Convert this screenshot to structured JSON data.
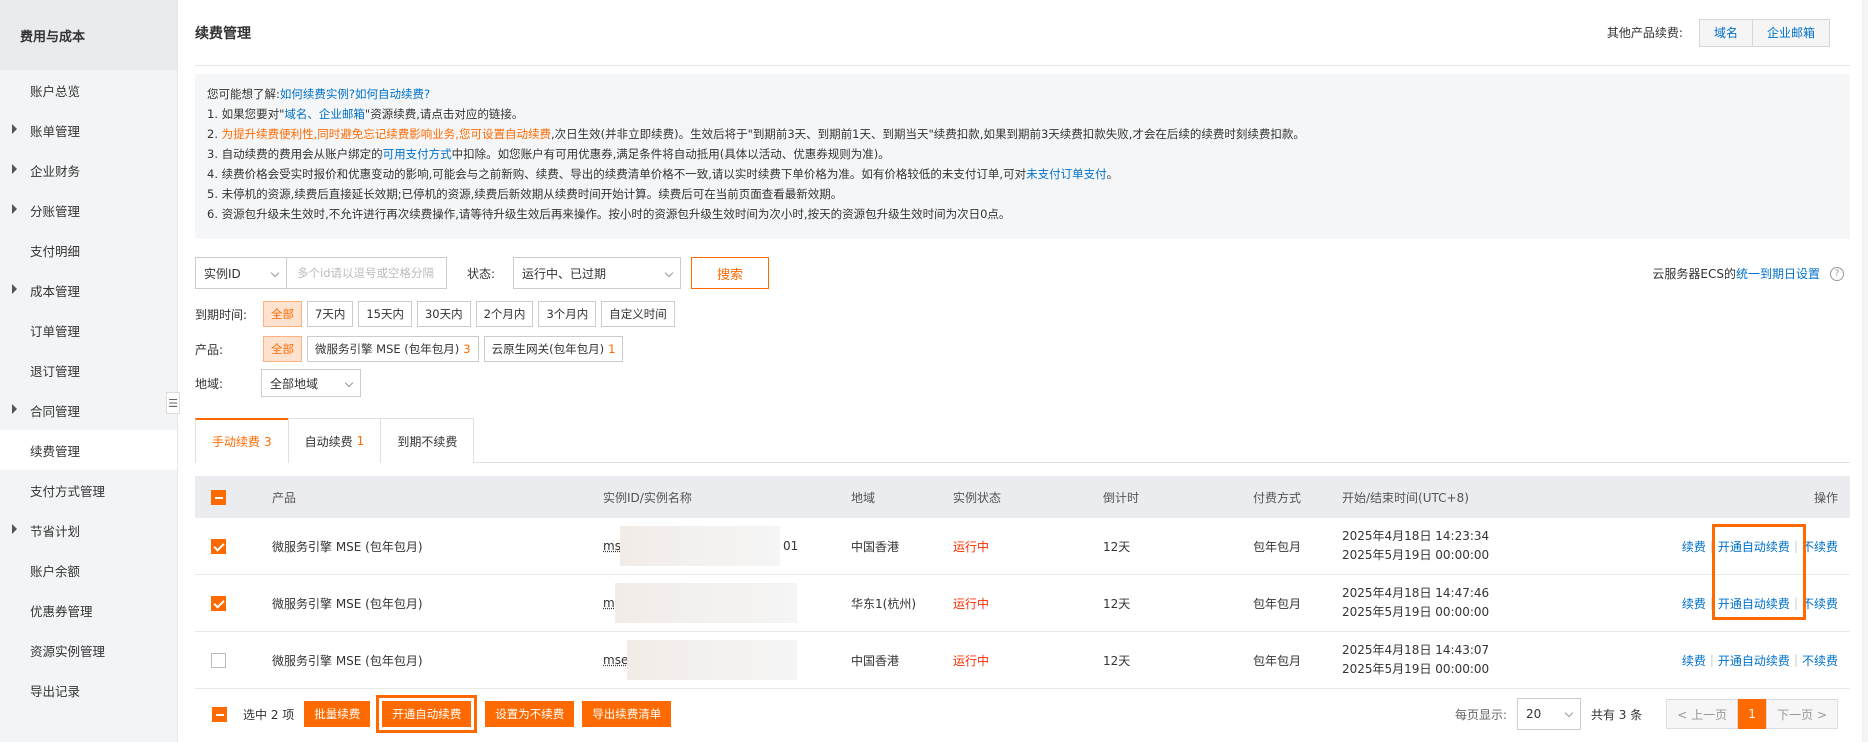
{
  "sidebar": {
    "header": "费用与成本",
    "items": [
      {
        "label": "账户总览",
        "caret": false
      },
      {
        "label": "账单管理",
        "caret": true
      },
      {
        "label": "企业财务",
        "caret": true
      },
      {
        "label": "分账管理",
        "caret": true
      },
      {
        "label": "支付明细",
        "caret": false
      },
      {
        "label": "成本管理",
        "caret": true
      },
      {
        "label": "订单管理",
        "caret": false
      },
      {
        "label": "退订管理",
        "caret": false
      },
      {
        "label": "合同管理",
        "caret": true
      },
      {
        "label": "续费管理",
        "caret": false,
        "active": true
      },
      {
        "label": "支付方式管理",
        "caret": false
      },
      {
        "label": "节省计划",
        "caret": true
      },
      {
        "label": "账户余额",
        "caret": false
      },
      {
        "label": "优惠券管理",
        "caret": false
      },
      {
        "label": "资源实例管理",
        "caret": false
      },
      {
        "label": "导出记录",
        "caret": false
      }
    ],
    "collapse_icon": "☰"
  },
  "header": {
    "title": "续费管理",
    "other_label": "其他产品续费:",
    "other_buttons": [
      "域名",
      "企业邮箱"
    ]
  },
  "notice": {
    "intro": "您可能想了解:",
    "intro_link": "如何续费实例?如何自动续费?",
    "l1_a": "1. 如果您要对\"",
    "l1_link": "域名、企业邮箱",
    "l1_b": "\"资源续费,请点击对应的链接。",
    "l2_a": "2. ",
    "l2_orange": "为提升续费便利性,同时避免忘记续费影响业务,您可设置自动续费",
    "l2_b": ",次日生效(并非立即续费)。生效后将于\"到期前3天、到期前1天、到期当天\"续费扣款,如果到期前3天续费扣款失败,才会在后续的续费时刻续费扣款。",
    "l3_a": "3. 自动续费的费用会从账户绑定的",
    "l3_link": "可用支付方式",
    "l3_b": "中扣除。如您账户有可用优惠券,满足条件将自动抵用(具体以活动、优惠券规则为准)。",
    "l4_a": "4. 续费价格会受实时报价和优惠变动的影响,可能会与之前新购、续费、导出的续费清单价格不一致,请以实时续费下单价格为准。如有价格较低的未支付订单,可对",
    "l4_link": "未支付订单支付",
    "l4_b": "。",
    "l5": "5. 未停机的资源,续费后直接延长效期;已停机的资源,续费后新效期从续费时间开始计算。续费后可在当前页面查看最新效期。",
    "l6": "6. 资源包升级未生效时,不允许进行再次续费操作,请等待升级生效后再来操作。按小时的资源包升级生效时间为次小时,按天的资源包升级生效时间为次日0点。"
  },
  "filter": {
    "id_select": "实例ID",
    "id_placeholder": "多个id请以逗号或空格分隔",
    "status_label": "状态:",
    "status_value": "运行中、已过期",
    "search_label": "搜索",
    "ecs_text": "云服务器ECS的",
    "ecs_link": "统一到期日设置",
    "help_icon": "?"
  },
  "expire": {
    "label": "到期时间:",
    "options": [
      "全部",
      "7天内",
      "15天内",
      "30天内",
      "2个月内",
      "3个月内",
      "自定义时间"
    ]
  },
  "product": {
    "label": "产品:",
    "options": [
      {
        "label": "全部",
        "count": ""
      },
      {
        "label": "微服务引擎 MSE (包年包月)",
        "count": "3"
      },
      {
        "label": "云原生网关(包年包月)",
        "count": "1"
      }
    ]
  },
  "region": {
    "label": "地域:",
    "value": "全部地域"
  },
  "tabs": [
    {
      "label": "手动续费",
      "count": "3"
    },
    {
      "label": "自动续费",
      "count": "1"
    },
    {
      "label": "到期不续费",
      "count": ""
    }
  ],
  "table": {
    "columns": {
      "product": "产品",
      "instance": "实例ID/实例名称",
      "region": "地域",
      "status": "实例状态",
      "countdown": "倒计时",
      "billing": "付费方式",
      "time": "开始/结束时间(UTC+8)",
      "ops": "操作"
    },
    "rows": [
      {
        "checked": true,
        "product": "微服务引擎 MSE (包年包月)",
        "instance_prefix": "mse_",
        "instance_suffix": "01",
        "region": "中国香港",
        "status": "运行中",
        "countdown": "12天",
        "billing": "包年包月",
        "start": "2025年4月18日 14:23:34",
        "end": "2025年5月19日 00:00:00"
      },
      {
        "checked": true,
        "product": "微服务引擎 MSE (包年包月)",
        "instance_prefix": "ms",
        "instance_suffix": "",
        "region": "华东1(杭州)",
        "status": "运行中",
        "countdown": "12天",
        "billing": "包年包月",
        "start": "2025年4月18日 14:47:46",
        "end": "2025年5月19日 00:00:00"
      },
      {
        "checked": false,
        "product": "微服务引擎 MSE (包年包月)",
        "instance_prefix": "mse_p",
        "instance_suffix": "",
        "region": "中国香港",
        "status": "运行中",
        "countdown": "12天",
        "billing": "包年包月",
        "start": "2025年4月18日 14:43:07",
        "end": "2025年5月19日 00:00:00"
      }
    ],
    "ops": [
      "续费",
      "开通自动续费",
      "不续费"
    ]
  },
  "footer": {
    "selected": "选中 2 项",
    "buttons": [
      "批量续费",
      "开通自动续费",
      "设置为不续费",
      "导出续费清单"
    ],
    "page_size_label": "每页显示:",
    "page_size": "20",
    "total": "共有 3 条",
    "prev": "< 上一页",
    "current": "1",
    "next": "下一页 >"
  }
}
